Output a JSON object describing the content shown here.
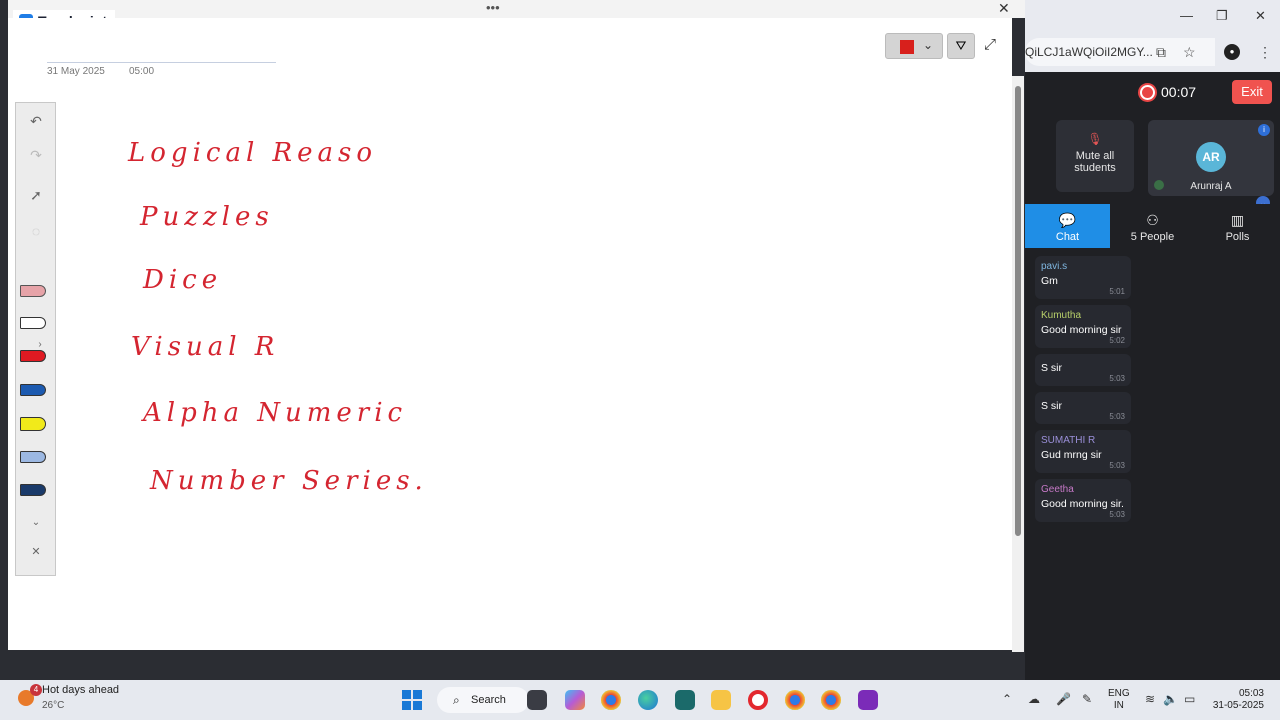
{
  "app": {
    "title": "Teachmint"
  },
  "browser": {
    "url": "QiLCJ1aWQiOiI2MGY...",
    "minimize_icon": "minimize-icon",
    "maximize_icon": "restore-icon",
    "close_icon": "close-icon"
  },
  "whiteboard": {
    "date": "31 May 2025",
    "time": "05:00",
    "pen_color": "#d8201c",
    "lines": [
      "Logical Reaso",
      "Puzzles",
      "Dice",
      "Visual R",
      "Alpha Numeric",
      "Number Series."
    ]
  },
  "class": {
    "timer": "00:07",
    "exit_label": "Exit",
    "mute_label_1": "Mute all",
    "mute_label_2": "students",
    "user_initials": "AR",
    "user_name": "Arunraj A"
  },
  "tabs": [
    {
      "label": "Chat",
      "icon": "chat-icon",
      "active": true
    },
    {
      "label": "5 People",
      "icon": "people-icon",
      "active": false
    },
    {
      "label": "Polls",
      "icon": "polls-icon",
      "active": false
    }
  ],
  "chat": [
    {
      "sender": "pavi.s",
      "color": "#7fb6e0",
      "text": "Gm",
      "time": "5:01"
    },
    {
      "sender": "Kumutha",
      "color": "#b8d06a",
      "text": "Good morning sir",
      "time": "5:02"
    },
    {
      "sender": "",
      "color": "#ffffff",
      "text": "S sir",
      "time": "5:03"
    },
    {
      "sender": "",
      "color": "#ffffff",
      "text": "S sir",
      "time": "5:03"
    },
    {
      "sender": "SUMATHI R",
      "color": "#9a8fd8",
      "text": "Gud mrng sir",
      "time": "5:03"
    },
    {
      "sender": "Geetha",
      "color": "#c779c8",
      "text": "Good morning sir.",
      "time": "5:03"
    }
  ],
  "taskbar": {
    "weather_title": "Hot days ahead",
    "weather_temp": "26°C",
    "weather_badge": "4",
    "search_label": "Search",
    "lang_1": "ENG",
    "lang_2": "IN",
    "clock_time": "05:03",
    "clock_date": "31-05-2025"
  }
}
